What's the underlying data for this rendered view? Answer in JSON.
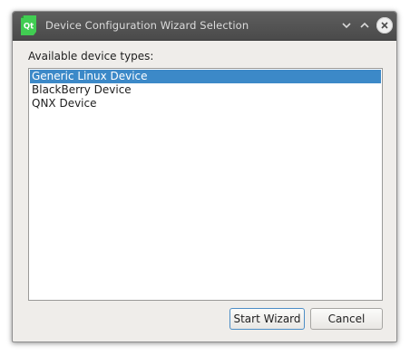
{
  "window": {
    "title": "Device Configuration Wizard Selection",
    "app_icon_text": "Qt"
  },
  "titlebar_buttons": [
    "minimize",
    "maximize",
    "close"
  ],
  "main": {
    "label": "Available device types:",
    "device_types": [
      {
        "label": "Generic Linux Device",
        "selected": true
      },
      {
        "label": "BlackBerry Device",
        "selected": false
      },
      {
        "label": "QNX Device",
        "selected": false
      }
    ]
  },
  "footer": {
    "start_wizard_label": "Start Wizard",
    "cancel_label": "Cancel"
  },
  "colors": {
    "selection": "#3c89c8",
    "titlebar": "#4f4f4f",
    "qt_green": "#41cd52"
  }
}
